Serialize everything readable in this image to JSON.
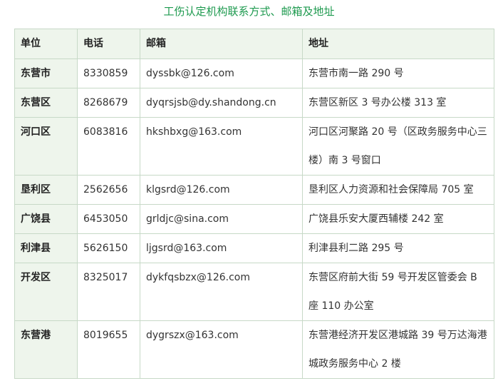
{
  "title": "工伤认定机构联系方式、邮箱及地址",
  "table": {
    "headers": {
      "unit": "单位",
      "phone": "电话",
      "email": "邮箱",
      "address": "地址"
    },
    "rows": [
      {
        "unit": "东营市",
        "phone": "8330859",
        "email": "dyssbk@126.com",
        "address": "东营市南一路 290 号"
      },
      {
        "unit": "东营区",
        "phone": "8268679",
        "email": "dyqrsjsb@dy.shandong.cn",
        "address": "东营区新区 3 号办公楼 313 室"
      },
      {
        "unit": "河口区",
        "phone": "6083816",
        "email": "hkshbxg@163.com",
        "address": "河口区河聚路 20 号（区政务服务中心三楼）南 3 号窗口"
      },
      {
        "unit": "垦利区",
        "phone": "2562656",
        "email": "klgsrd@126.com",
        "address": "垦利区人力资源和社会保障局 705 室"
      },
      {
        "unit": "广饶县",
        "phone": "6453050",
        "email": "grldjc@sina.com",
        "address": "广饶县乐安大厦西辅楼 242 室"
      },
      {
        "unit": "利津县",
        "phone": "5626150",
        "email": "ljgsrd@163.com",
        "address": "利津县利二路 295 号"
      },
      {
        "unit": "开发区",
        "phone": "8325017",
        "email": "dykfqsbzx@126.com",
        "address": "东营区府前大街 59 号开发区管委会 B 座 110 办公室"
      },
      {
        "unit": "东营港",
        "phone": "8019655",
        "email": "dygrszx@163.com",
        "address": "东营港经济开发区港城路 39 号万达海港城政务服务中心 2 楼"
      }
    ]
  }
}
